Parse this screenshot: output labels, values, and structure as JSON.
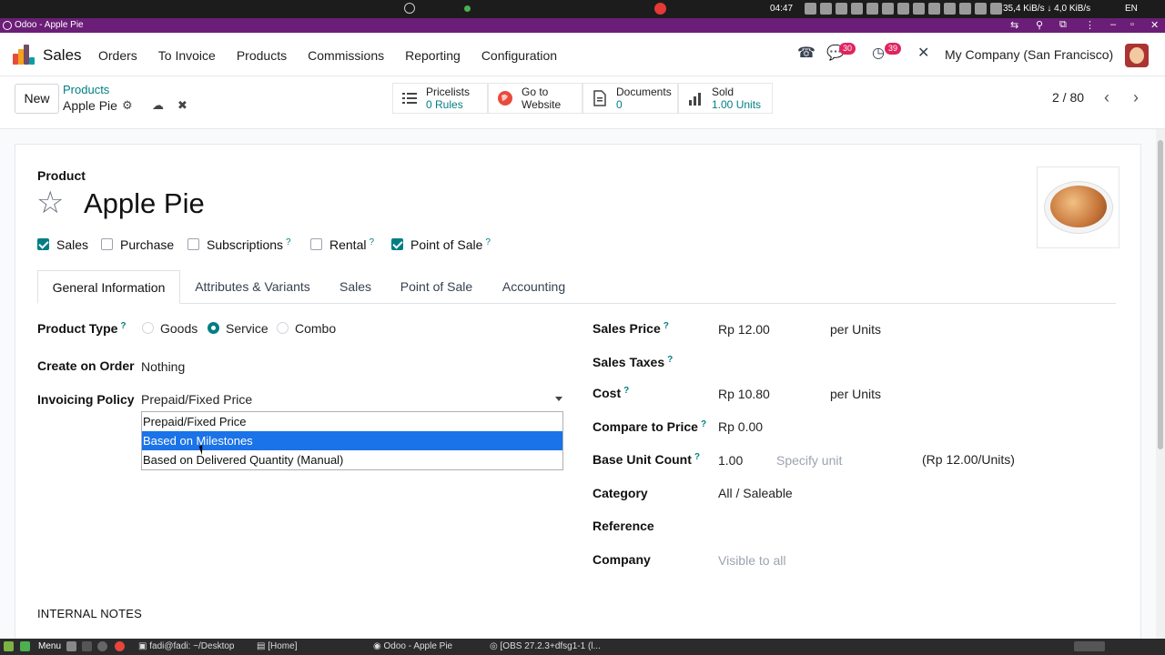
{
  "system": {
    "clock": "04:47",
    "net": "35,4 KiB/s ↓ 4,0 KiB/s",
    "lang": "EN"
  },
  "browser": {
    "tab_title": "Odoo - Apple Pie"
  },
  "nav": {
    "app": "Sales",
    "menu": [
      "Orders",
      "To Invoice",
      "Products",
      "Commissions",
      "Reporting",
      "Configuration"
    ],
    "chat_badge": "30",
    "activity_badge": "39",
    "company": "My Company (San Francisco)"
  },
  "control": {
    "new_label": "New",
    "breadcrumb_parent": "Products",
    "breadcrumb_current": "Apple Pie",
    "stats": [
      {
        "title": "Pricelists",
        "value": "0 Rules"
      },
      {
        "title": "Go to",
        "value": "Website"
      },
      {
        "title": "Documents",
        "value": "0"
      },
      {
        "title": "Sold",
        "value": "1.00 Units"
      }
    ],
    "pager": "2 / 80"
  },
  "form": {
    "type_label": "Product",
    "name": "Apple Pie",
    "flags": [
      {
        "label": "Sales",
        "checked": true
      },
      {
        "label": "Purchase",
        "checked": false
      },
      {
        "label": "Subscriptions",
        "checked": false
      },
      {
        "label": "Rental",
        "checked": false
      },
      {
        "label": "Point of Sale",
        "checked": true
      }
    ],
    "tabs": [
      "General Information",
      "Attributes & Variants",
      "Sales",
      "Point of Sale",
      "Accounting"
    ],
    "left": {
      "product_type_label": "Product Type",
      "product_type_options": [
        "Goods",
        "Service",
        "Combo"
      ],
      "product_type_selected": "Service",
      "create_on_order_label": "Create on Order",
      "create_on_order_value": "Nothing",
      "invoicing_policy_label": "Invoicing Policy",
      "invoicing_policy_value": "Prepaid/Fixed Price",
      "invoicing_options": [
        "Prepaid/Fixed Price",
        "Based on Milestones",
        "Based on Delivered Quantity (Manual)"
      ],
      "invoicing_highlighted": "Based on Milestones"
    },
    "right": {
      "sales_price_label": "Sales Price",
      "sales_price_value": "Rp 12.00",
      "sales_price_unit": "per Units",
      "sales_taxes_label": "Sales Taxes",
      "cost_label": "Cost",
      "cost_value": "Rp 10.80",
      "cost_unit": "per Units",
      "compare_label": "Compare to Price",
      "compare_value": "Rp 0.00",
      "base_unit_label": "Base Unit Count",
      "base_unit_value": "1.00",
      "base_unit_placeholder": "Specify unit",
      "base_unit_price": "(Rp 12.00/Units)",
      "category_label": "Category",
      "category_value": "All / Saleable",
      "reference_label": "Reference",
      "company_label": "Company",
      "company_placeholder": "Visible to all"
    },
    "internal_notes": "INTERNAL NOTES"
  },
  "taskbar": {
    "menu": "Menu",
    "items": [
      "fadi@fadi: ~/Desktop",
      "[Home]",
      "Odoo - Apple Pie",
      "[OBS 27.2.3+dfsg1-1 (l..."
    ]
  }
}
